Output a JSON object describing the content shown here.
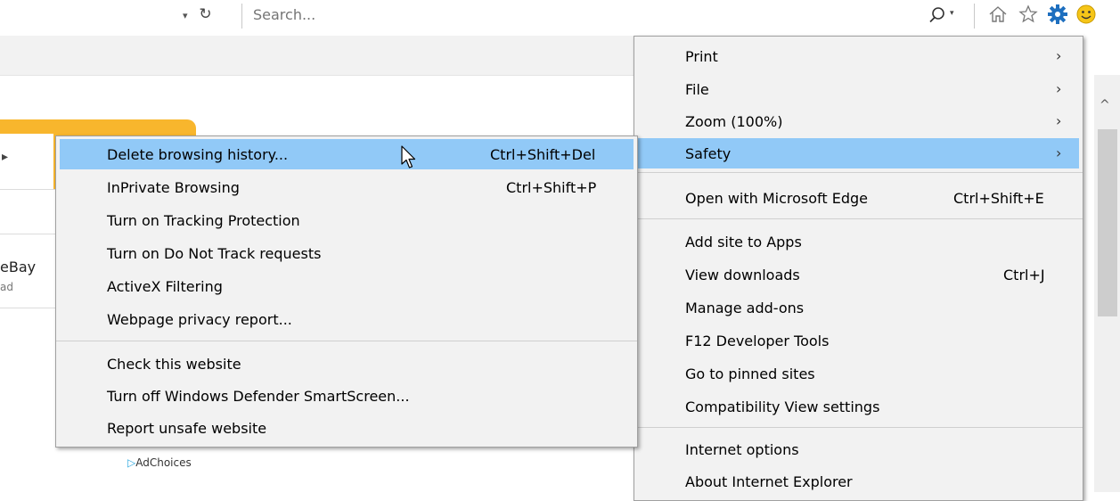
{
  "toolbar": {
    "search_placeholder": "Search...",
    "dropdown_glyph": "▾",
    "refresh_glyph": "↻",
    "icons": [
      "home-icon",
      "favorites-star-icon",
      "tools-gear-icon",
      "feedback-smiley-icon"
    ]
  },
  "page": {
    "ebay_text": "eBay",
    "ebay_sub": "ad",
    "adchoices": "AdChoices",
    "partial_glyph": "▸",
    "scroll_up_glyph": "^"
  },
  "main_menu": {
    "items": [
      {
        "label": "Print",
        "has_submenu": true
      },
      {
        "label": "File",
        "has_submenu": true
      },
      {
        "label": "Zoom (100%)",
        "has_submenu": true
      },
      {
        "label": "Safety",
        "has_submenu": true,
        "highlighted": true
      },
      {
        "label": "Open with Microsoft Edge",
        "shortcut": "Ctrl+Shift+E"
      },
      {
        "label": "Add site to Apps"
      },
      {
        "label": "View downloads",
        "shortcut": "Ctrl+J"
      },
      {
        "label": "Manage add-ons"
      },
      {
        "label": "F12 Developer Tools"
      },
      {
        "label": "Go to pinned sites"
      },
      {
        "label": "Compatibility View settings"
      },
      {
        "label": "Internet options"
      },
      {
        "label": "About Internet Explorer"
      }
    ],
    "arrow_glyph": "›"
  },
  "safety_submenu": {
    "items": [
      {
        "label": "Delete browsing history...",
        "shortcut": "Ctrl+Shift+Del",
        "highlighted": true
      },
      {
        "label": "InPrivate Browsing",
        "shortcut": "Ctrl+Shift+P"
      },
      {
        "label": "Turn on Tracking Protection"
      },
      {
        "label": "Turn on Do Not Track requests"
      },
      {
        "label": "ActiveX Filtering"
      },
      {
        "label": "Webpage privacy report..."
      },
      {
        "label": "Check this website"
      },
      {
        "label": "Turn off Windows Defender SmartScreen..."
      },
      {
        "label": "Report unsafe website"
      }
    ]
  },
  "colors": {
    "menu_bg": "#f2f2f2",
    "highlight": "#91c9f7",
    "orange_tab": "#f8b62d",
    "gear_blue": "#1e6fbf",
    "smiley_yellow": "#f5c518"
  }
}
